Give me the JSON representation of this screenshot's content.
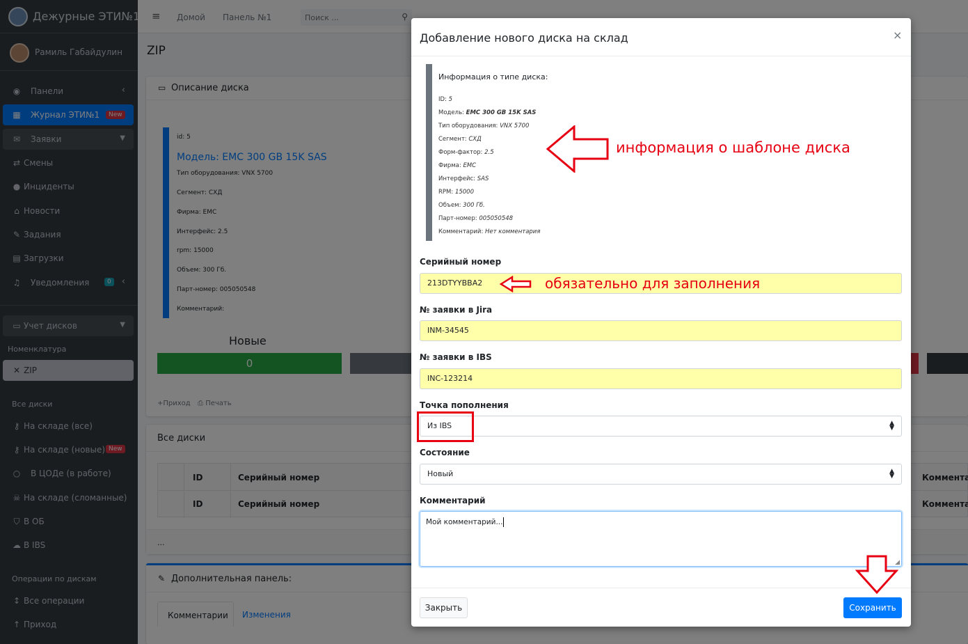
{
  "sidebar": {
    "brand": "Дежурные ЭТИ№1",
    "user": "Рамиль Габайдулин",
    "items": {
      "panels": "Панели",
      "journal": "Журнал ЭТИ№1",
      "journal_badge": "New",
      "requests": "Заявки",
      "shifts": "Смены",
      "incidents": "Инциденты",
      "news": "Новости",
      "tasks": "Задания",
      "downloads": "Загрузки",
      "notifications": "Уведомления",
      "notifications_badge": "0",
      "disks": "Учет дисков",
      "nomenclature": "Номенклатура",
      "zip": "ZIP",
      "all_disks_head": "Все диски",
      "stock_all": "На складе (все)",
      "stock_new": "На складе (новые)",
      "stock_new_badge": "New",
      "in_dc": "В ЦОДе (в работе)",
      "stock_broken": "На складе (сломанные)",
      "in_ob": "В ОБ",
      "in_ibs": "В IBS",
      "ops_head": "Операции по дискам",
      "all_ops": "Все операции",
      "income": "Приход"
    }
  },
  "topnav": {
    "home": "Домой",
    "panel": "Панель №1",
    "search_placeholder": "Поиск ..."
  },
  "page": {
    "title": "ZIP",
    "disk_card": {
      "header": "Описание диска",
      "id": "id: 5",
      "model": "Модель: EMC 300 GB 15K SAS",
      "equipment": "Тип оборудования: VNX 5700",
      "segment": "Сегмент: СХД",
      "firm": "Фирма: EMC",
      "interface": "Интерфейс: 2.5",
      "rpm": "rpm: 15000",
      "volume": "Объем: 300 Гб.",
      "part": "Парт-номер: 005050548",
      "comment": "Комментарий:",
      "new_label": "Новые",
      "new_count": "0",
      "action_income": "Приход",
      "action_print": "Печать"
    },
    "all_disks": {
      "header": "Все диски",
      "col_id": "ID",
      "col_serial": "Серийный номер",
      "col_comment": "Комментари",
      "ellipsis": "..."
    },
    "extra_panel": {
      "header": "Дополнительная панель:",
      "tab_comments": "Комментарии",
      "tab_changes": "Изменения"
    }
  },
  "modal": {
    "title": "Добавление нового диска на склад",
    "close": "×",
    "info": {
      "title": "Информация о типе диска:",
      "lines": [
        {
          "label": "ID:",
          "value": "5"
        },
        {
          "label": "Модель:",
          "value": "EMC 300 GB 15K SAS"
        },
        {
          "label": "Тип оборудования:",
          "value": "VNX 5700"
        },
        {
          "label": "Сегмент:",
          "value": "СХД"
        },
        {
          "label": "Форм-фактор:",
          "value": "2.5"
        },
        {
          "label": "Фирма:",
          "value": "EMC"
        },
        {
          "label": "Интерфейс:",
          "value": "SAS"
        },
        {
          "label": "RPM:",
          "value": "15000"
        },
        {
          "label": "Объем:",
          "value": "300 Гб."
        },
        {
          "label": "Парт-номер:",
          "value": "005050548"
        },
        {
          "label": "Комментарий:",
          "value": "Нет комментария"
        }
      ]
    },
    "fields": {
      "serial_label": "Серийный номер",
      "serial_value": "213DTYYBBA2",
      "jira_label": "№ заявки в Jira",
      "jira_value": "INM-34545",
      "ibs_label": "№ заявки в IBS",
      "ibs_value": "INC-123214",
      "source_label": "Точка пополнения",
      "source_value": "Из IBS",
      "state_label": "Состояние",
      "state_value": "Новый",
      "comment_label": "Комментарий",
      "comment_value": "Мой комментарий..."
    },
    "buttons": {
      "close": "Закрыть",
      "save": "Сохранить"
    }
  },
  "annotations": {
    "template_info": "информация о шаблоне диска",
    "required": "обязательно для заполнения"
  },
  "colors": {
    "accent": "#007bff",
    "sidebar": "#343a40",
    "annotation": "#e60012",
    "highlight": "#fffea9"
  }
}
